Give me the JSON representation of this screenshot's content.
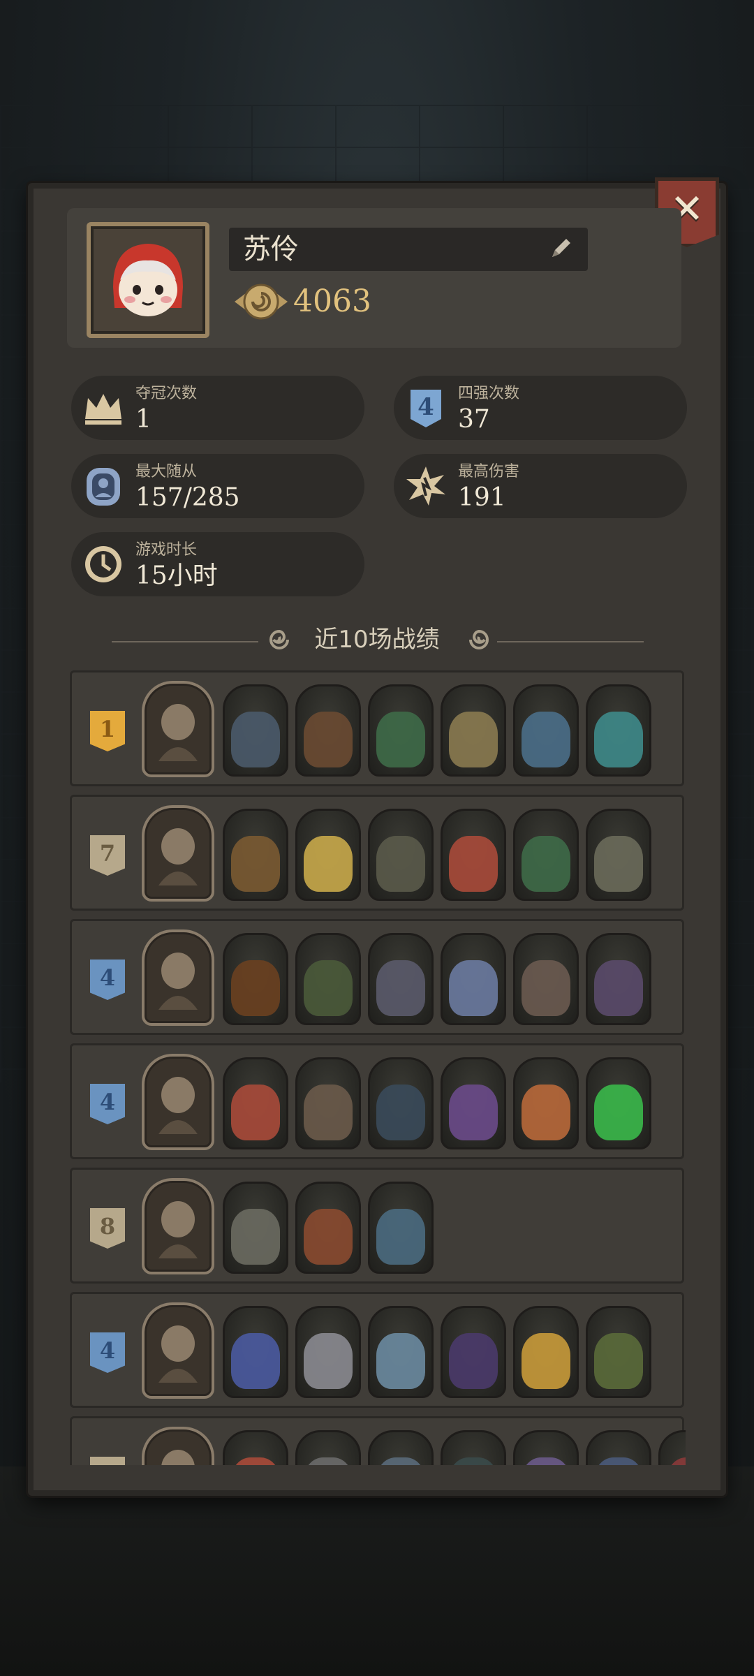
{
  "profile": {
    "name": "苏伶",
    "coins": "4063"
  },
  "stats": {
    "championships": {
      "label": "夺冠次数",
      "value": "1",
      "icon": "crown-icon"
    },
    "top4": {
      "label": "四强次数",
      "value": "37",
      "icon": "rank-four-badge-icon",
      "badge_text": "4"
    },
    "max_minions": {
      "label": "最大随从",
      "value": "157/285",
      "icon": "minion-card-icon"
    },
    "max_damage": {
      "label": "最高伤害",
      "value": "191",
      "icon": "damage-burst-icon"
    },
    "play_time": {
      "label": "游戏时长",
      "value": "15小时",
      "icon": "clock-icon"
    }
  },
  "recent": {
    "title": "近10场战绩",
    "matches": [
      {
        "rank": "1",
        "rank_color": "gold",
        "unit_colors": [
          "#4a5a6a",
          "#6a4a32",
          "#3e6a48",
          "#8a7a50",
          "#4a6e88",
          "#3e8a8a"
        ]
      },
      {
        "rank": "7",
        "rank_color": "silver",
        "unit_colors": [
          "#7a5a32",
          "#c8a84a",
          "#5a5a4a",
          "#a84a3a",
          "#3e6a48",
          "#6a6a5a"
        ]
      },
      {
        "rank": "4",
        "rank_color": "blue",
        "unit_colors": [
          "#6a4020",
          "#4a5a3a",
          "#5a5a6a",
          "#6a7aa0",
          "#6a5a50",
          "#5a4a6a"
        ]
      },
      {
        "rank": "4",
        "rank_color": "blue",
        "unit_colors": [
          "#a84a3a",
          "#6a5a4a",
          "#3a4a5a",
          "#6a4a8a",
          "#b8683a",
          "#3ab84a"
        ]
      },
      {
        "rank": "8",
        "rank_color": "silver",
        "unit_colors": [
          "#6a6a60",
          "#8a4a30",
          "#4a6a80"
        ]
      },
      {
        "rank": "4",
        "rank_color": "blue",
        "unit_colors": [
          "#4a5aa0",
          "#8a8a90",
          "#6a8aa0",
          "#4a3a6a",
          "#c89a3a",
          "#5a6a3a"
        ]
      },
      {
        "rank": "",
        "rank_color": "silver",
        "unit_colors": [
          "#a84a3a",
          "#6a6a6a",
          "#5a6a7a",
          "#3a4a4a",
          "#6a5a8a",
          "#4a5a7a",
          "#8a3a3a"
        ]
      }
    ]
  }
}
